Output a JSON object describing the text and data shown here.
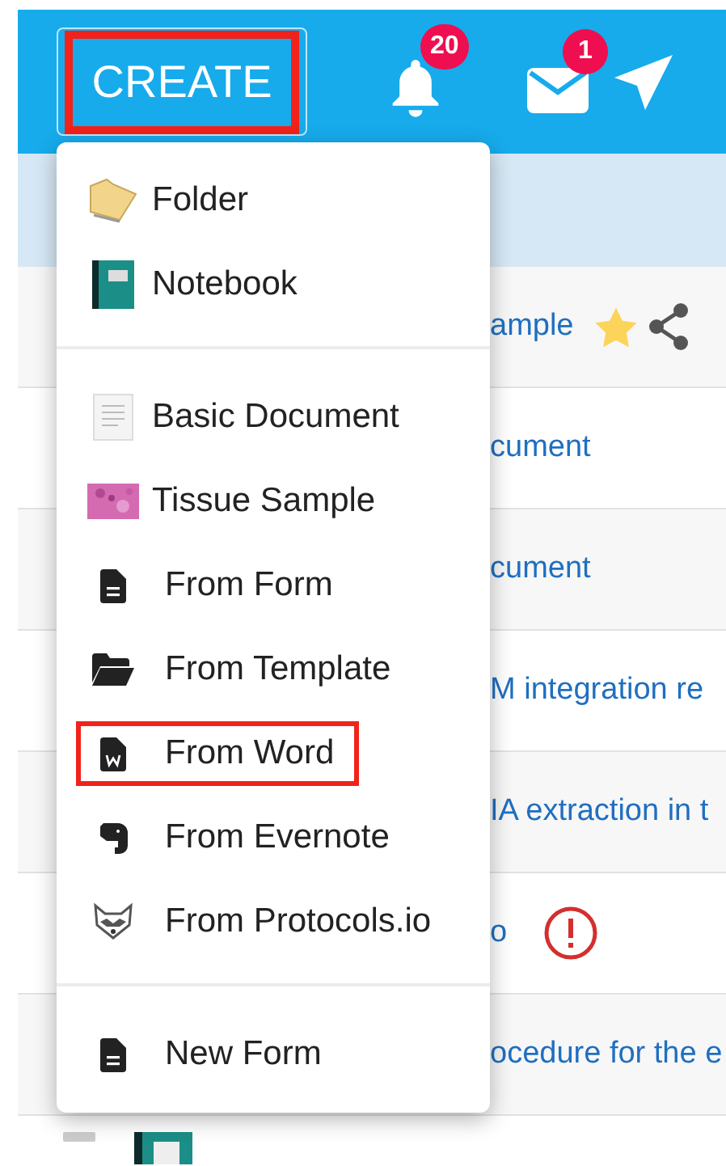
{
  "header": {
    "create_button": {
      "label": "CREATE",
      "highlighted": true
    },
    "notifications": {
      "count": "20"
    },
    "messages": {
      "count": "1"
    }
  },
  "create_menu": {
    "sections": [
      [
        {
          "label": "Folder",
          "highlighted": false
        },
        {
          "label": "Notebook",
          "highlighted": false
        }
      ],
      [
        {
          "label": "Basic Document",
          "highlighted": false
        },
        {
          "label": "Tissue Sample",
          "highlighted": false
        },
        {
          "label": "From Form",
          "highlighted": false
        },
        {
          "label": "From Template",
          "highlighted": false
        },
        {
          "label": "From Word",
          "highlighted": true
        },
        {
          "label": "From Evernote",
          "highlighted": false
        },
        {
          "label": "From Protocols.io",
          "highlighted": false
        }
      ],
      [
        {
          "label": "New Form",
          "highlighted": false
        }
      ]
    ]
  },
  "table": {
    "rows": [
      {
        "name": "ample",
        "starred": true,
        "shared": true,
        "warning": false
      },
      {
        "name": "cument",
        "starred": false,
        "shared": false,
        "warning": false
      },
      {
        "name": "cument",
        "starred": false,
        "shared": false,
        "warning": false
      },
      {
        "name": "M integration re",
        "starred": false,
        "shared": false,
        "warning": false
      },
      {
        "name": "IA extraction in t",
        "starred": false,
        "shared": false,
        "warning": false
      },
      {
        "name": "o",
        "starred": false,
        "shared": false,
        "warning": true
      },
      {
        "name": "ocedure for the e",
        "starred": false,
        "shared": false,
        "warning": false
      }
    ]
  }
}
